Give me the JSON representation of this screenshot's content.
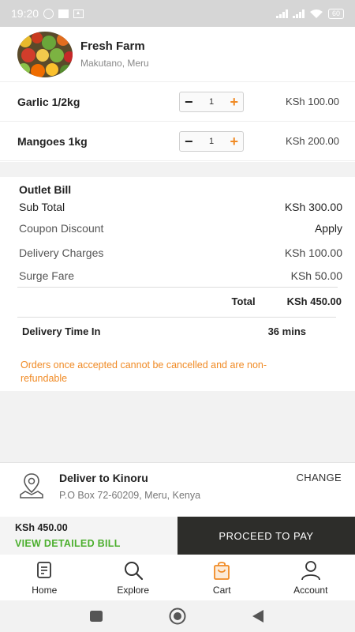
{
  "status_bar": {
    "time": "19:20",
    "battery": "60"
  },
  "store": {
    "name": "Fresh Farm",
    "location": "Makutano, Meru"
  },
  "cart_items": [
    {
      "name": "Garlic 1/2kg",
      "qty": "1",
      "price": "KSh 100.00"
    },
    {
      "name": "Mangoes 1kg",
      "qty": "1",
      "price": "KSh 200.00"
    }
  ],
  "bill": {
    "title": "Outlet Bill",
    "sub_total_label": "Sub Total",
    "sub_total_value": "KSh 300.00",
    "coupon_label": "Coupon Discount",
    "coupon_value": "Apply",
    "delivery_label": "Delivery Charges",
    "delivery_value": "KSh 100.00",
    "surge_label": "Surge Fare",
    "surge_value": "KSh 50.00",
    "total_label": "Total",
    "total_value": "KSh 450.00",
    "delivery_time_label": "Delivery Time In",
    "delivery_time_value": "36 mins",
    "notice": "Orders once accepted cannot be cancelled and are non-refundable"
  },
  "delivery": {
    "title": "Deliver to Kinoru",
    "address": "P.O Box 72-60209, Meru, Kenya",
    "change_label": "CHANGE"
  },
  "pay_bar": {
    "total": "KSh 450.00",
    "view_bill_label": "VIEW DETAILED BILL",
    "proceed_label": "PROCEED TO PAY"
  },
  "bottom_nav": [
    {
      "label": "Home",
      "icon": "home-icon"
    },
    {
      "label": "Explore",
      "icon": "search-icon"
    },
    {
      "label": "Cart",
      "icon": "cart-bag-icon",
      "active": true
    },
    {
      "label": "Account",
      "icon": "account-icon"
    }
  ],
  "colors": {
    "accent": "#f08a24",
    "link_green": "#4caf2e",
    "pay_button": "#2d2d2a"
  }
}
